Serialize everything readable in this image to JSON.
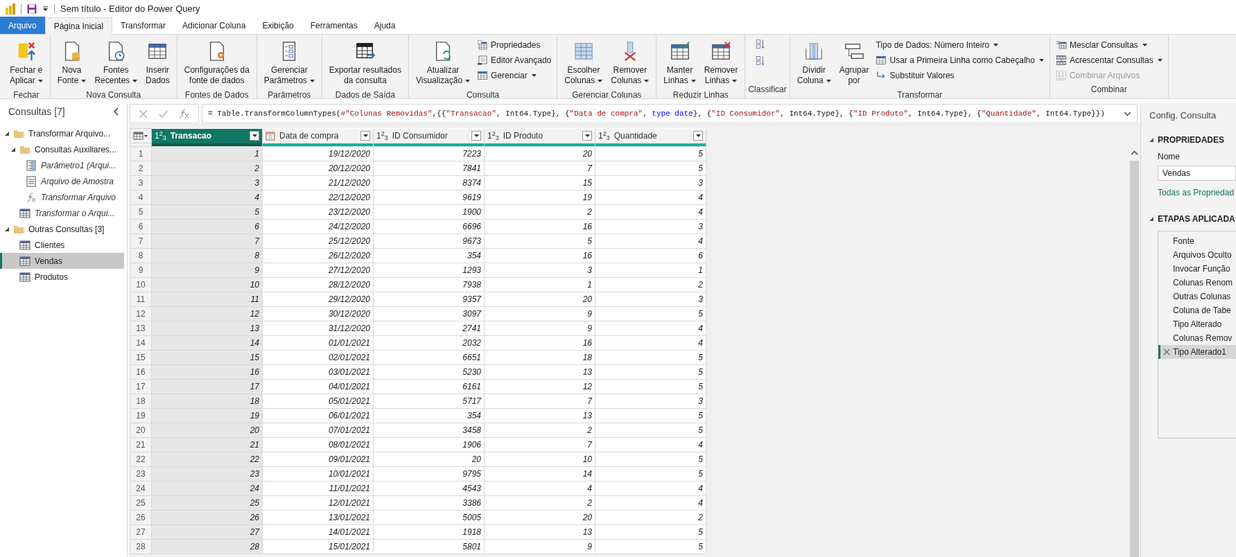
{
  "window": {
    "title": "Sem título - Editor do Power Query"
  },
  "tabs": [
    {
      "label": "Arquivo",
      "kind": "file",
      "selected": false
    },
    {
      "label": "Página Inicial",
      "kind": "tab",
      "selected": true
    },
    {
      "label": "Transformar",
      "kind": "tab",
      "selected": false
    },
    {
      "label": "Adicionar Coluna",
      "kind": "tab",
      "selected": false
    },
    {
      "label": "Exibição",
      "kind": "tab",
      "selected": false
    },
    {
      "label": "Ferramentas",
      "kind": "tab",
      "selected": false
    },
    {
      "label": "Ajuda",
      "kind": "tab",
      "selected": false
    }
  ],
  "ribbon": {
    "groups": [
      {
        "label": "Fechar",
        "items": [
          {
            "kind": "large",
            "lines": [
              "Fechar e",
              "Aplicar"
            ],
            "dropdown": true
          }
        ]
      },
      {
        "label": "Nova Consulta",
        "items": [
          {
            "kind": "large",
            "lines": [
              "Nova",
              "Fonte"
            ],
            "dropdown": true
          },
          {
            "kind": "large",
            "lines": [
              "Fontes",
              "Recentes"
            ],
            "dropdown": true
          },
          {
            "kind": "large",
            "lines": [
              "Inserir",
              "Dados"
            ],
            "dropdown": false
          }
        ]
      },
      {
        "label": "Fontes de Dados",
        "items": [
          {
            "kind": "large",
            "lines": [
              "Configurações da",
              "fonte de dados"
            ],
            "dropdown": false
          }
        ]
      },
      {
        "label": "Parâmetros",
        "items": [
          {
            "kind": "large",
            "lines": [
              "Gerenciar",
              "Parâmetros"
            ],
            "dropdown": true
          }
        ]
      },
      {
        "label": "Dados de Saída",
        "items": [
          {
            "kind": "large",
            "lines": [
              "Exportar resultados",
              "da consulta"
            ],
            "dropdown": false
          }
        ]
      },
      {
        "label": "Consulta",
        "items": [
          {
            "kind": "large",
            "lines": [
              "Atualizar",
              "Visualização"
            ],
            "dropdown": true
          },
          {
            "kind": "small",
            "label": "Propriedades",
            "dropdown": false,
            "disabled": false
          },
          {
            "kind": "small",
            "label": "Editor Avançado",
            "dropdown": false,
            "disabled": false
          },
          {
            "kind": "small",
            "label": "Gerenciar",
            "dropdown": true,
            "disabled": false
          }
        ]
      },
      {
        "label": "Gerenciar Colunas",
        "items": [
          {
            "kind": "large",
            "lines": [
              "Escolher",
              "Colunas"
            ],
            "dropdown": true
          },
          {
            "kind": "large",
            "lines": [
              "Remover",
              "Colunas"
            ],
            "dropdown": true
          }
        ]
      },
      {
        "label": "Reduzir Linhas",
        "items": [
          {
            "kind": "large",
            "lines": [
              "Manter",
              "Linhas"
            ],
            "dropdown": true
          },
          {
            "kind": "large",
            "lines": [
              "Remover",
              "Linhas"
            ],
            "dropdown": true
          }
        ]
      },
      {
        "label": "Classificar",
        "items": [
          {
            "kind": "icon"
          },
          {
            "kind": "icon"
          }
        ]
      },
      {
        "label": "Transformar",
        "items": [
          {
            "kind": "large",
            "lines": [
              "Dividir",
              "Coluna"
            ],
            "dropdown": true
          },
          {
            "kind": "large",
            "lines": [
              "Agrupar",
              "por"
            ],
            "dropdown": false
          },
          {
            "kind": "small",
            "label": "Tipo de Dados: Número Inteiro",
            "dropdown": true,
            "disabled": false
          },
          {
            "kind": "small",
            "label": "Usar a Primeira Linha como Cabeçalho",
            "dropdown": true,
            "disabled": false
          },
          {
            "kind": "small",
            "label": "Substituir Valores",
            "dropdown": false,
            "disabled": false
          }
        ]
      },
      {
        "label": "Combinar",
        "items": [
          {
            "kind": "small",
            "label": "Mesclar Consultas",
            "dropdown": true,
            "disabled": false
          },
          {
            "kind": "small",
            "label": "Acrescentar Consultas",
            "dropdown": true,
            "disabled": false
          },
          {
            "kind": "small",
            "label": "Combinar Arquivos",
            "dropdown": false,
            "disabled": true
          }
        ]
      }
    ]
  },
  "queries": {
    "title": "Consultas [7]",
    "items": [
      {
        "label": "Transformar Arquivo...",
        "kind": "folder",
        "italic": false,
        "selected": false,
        "expanded": true,
        "children": [
          {
            "label": "Consultas Auxiliares...",
            "kind": "folder",
            "italic": false,
            "selected": false,
            "expanded": true,
            "children": [
              {
                "label": "Parâmetro1 (Arqui...",
                "kind": "param",
                "italic": true,
                "selected": false
              },
              {
                "label": "Arquivo de Amostra",
                "kind": "file",
                "italic": true,
                "selected": false
              },
              {
                "label": "Transformar Arquivo",
                "kind": "function",
                "italic": true,
                "selected": false
              }
            ]
          },
          {
            "label": "Transformar o Arqui...",
            "kind": "table",
            "italic": true,
            "selected": false
          }
        ]
      },
      {
        "label": "Outras Consultas [3]",
        "kind": "folder",
        "italic": false,
        "selected": false,
        "expanded": true,
        "children": [
          {
            "label": "Clientes",
            "kind": "table",
            "italic": false,
            "selected": false
          },
          {
            "label": "Vendas",
            "kind": "table",
            "italic": false,
            "selected": true
          },
          {
            "label": "Produtos",
            "kind": "table",
            "italic": false,
            "selected": false
          }
        ]
      }
    ]
  },
  "formula": [
    {
      "text": "= Table.TransformColumnTypes(",
      "kind": "plain"
    },
    {
      "text": "#\"Colunas Removidas\"",
      "kind": "string"
    },
    {
      "text": ",{{",
      "kind": "plain"
    },
    {
      "text": "\"Transacao\"",
      "kind": "string"
    },
    {
      "text": ", Int64.Type}, {",
      "kind": "plain"
    },
    {
      "text": "\"Data de compra\"",
      "kind": "string"
    },
    {
      "text": ", ",
      "kind": "plain"
    },
    {
      "text": "type date",
      "kind": "keyword"
    },
    {
      "text": "}, {",
      "kind": "plain"
    },
    {
      "text": "\"ID Consumidor\"",
      "kind": "string"
    },
    {
      "text": ", Int64.Type}, {",
      "kind": "plain"
    },
    {
      "text": "\"ID Produto\"",
      "kind": "string"
    },
    {
      "text": ", Int64.Type}, {",
      "kind": "plain"
    },
    {
      "text": "\"Quantidade\"",
      "kind": "string"
    },
    {
      "text": ", Int64.Type}})",
      "kind": "plain"
    }
  ],
  "table": {
    "columns": [
      {
        "name": "Transacao",
        "kind": "int",
        "type_symbol": "1$^{2}$$_{3}$",
        "selected": true
      },
      {
        "name": "Data de compra",
        "kind": "date",
        "selected": false
      },
      {
        "name": "ID Consumidor",
        "kind": "int",
        "type_symbol": "1$^{2}$$_{3}$",
        "selected": false
      },
      {
        "name": "ID Produto",
        "kind": "int",
        "type_symbol": "1$^{2}$$_{3}$",
        "selected": false
      },
      {
        "name": "Quantidade",
        "kind": "int",
        "type_symbol": "1$^{2}$$_{3}$",
        "selected": false
      }
    ],
    "rows": [
      {
        "number": "1",
        "cells": [
          "1",
          "19/12/2020",
          "7223",
          "20",
          "5"
        ]
      },
      {
        "number": "2",
        "cells": [
          "2",
          "20/12/2020",
          "7841",
          "7",
          "5"
        ]
      },
      {
        "number": "3",
        "cells": [
          "3",
          "21/12/2020",
          "8374",
          "15",
          "3"
        ]
      },
      {
        "number": "4",
        "cells": [
          "4",
          "22/12/2020",
          "9619",
          "19",
          "4"
        ]
      },
      {
        "number": "5",
        "cells": [
          "5",
          "23/12/2020",
          "1900",
          "2",
          "4"
        ]
      },
      {
        "number": "6",
        "cells": [
          "6",
          "24/12/2020",
          "6696",
          "16",
          "3"
        ]
      },
      {
        "number": "7",
        "cells": [
          "7",
          "25/12/2020",
          "9673",
          "5",
          "4"
        ]
      },
      {
        "number": "8",
        "cells": [
          "8",
          "26/12/2020",
          "354",
          "16",
          "6"
        ]
      },
      {
        "number": "9",
        "cells": [
          "9",
          "27/12/2020",
          "1293",
          "3",
          "1"
        ]
      },
      {
        "number": "10",
        "cells": [
          "10",
          "28/12/2020",
          "7938",
          "1",
          "2"
        ]
      },
      {
        "number": "11",
        "cells": [
          "11",
          "29/12/2020",
          "9357",
          "20",
          "3"
        ]
      },
      {
        "number": "12",
        "cells": [
          "12",
          "30/12/2020",
          "3097",
          "9",
          "5"
        ]
      },
      {
        "number": "13",
        "cells": [
          "13",
          "31/12/2020",
          "2741",
          "9",
          "4"
        ]
      },
      {
        "number": "14",
        "cells": [
          "14",
          "01/01/2021",
          "2032",
          "16",
          "4"
        ]
      },
      {
        "number": "15",
        "cells": [
          "15",
          "02/01/2021",
          "6651",
          "18",
          "5"
        ]
      },
      {
        "number": "16",
        "cells": [
          "16",
          "03/01/2021",
          "5230",
          "13",
          "5"
        ]
      },
      {
        "number": "17",
        "cells": [
          "17",
          "04/01/2021",
          "6161",
          "12",
          "5"
        ]
      },
      {
        "number": "18",
        "cells": [
          "18",
          "05/01/2021",
          "5717",
          "7",
          "3"
        ]
      },
      {
        "number": "19",
        "cells": [
          "19",
          "06/01/2021",
          "354",
          "13",
          "5"
        ]
      },
      {
        "number": "20",
        "cells": [
          "20",
          "07/01/2021",
          "3458",
          "2",
          "5"
        ]
      },
      {
        "number": "21",
        "cells": [
          "21",
          "08/01/2021",
          "1906",
          "7",
          "4"
        ]
      },
      {
        "number": "22",
        "cells": [
          "22",
          "09/01/2021",
          "20",
          "10",
          "5"
        ]
      },
      {
        "number": "23",
        "cells": [
          "23",
          "10/01/2021",
          "9795",
          "14",
          "5"
        ]
      },
      {
        "number": "24",
        "cells": [
          "24",
          "11/01/2021",
          "4543",
          "4",
          "4"
        ]
      },
      {
        "number": "25",
        "cells": [
          "25",
          "12/01/2021",
          "3386",
          "2",
          "4"
        ]
      },
      {
        "number": "26",
        "cells": [
          "26",
          "13/01/2021",
          "5005",
          "20",
          "2"
        ]
      },
      {
        "number": "27",
        "cells": [
          "27",
          "14/01/2021",
          "1918",
          "13",
          "5"
        ]
      },
      {
        "number": "28",
        "cells": [
          "28",
          "15/01/2021",
          "5801",
          "9",
          "5"
        ]
      }
    ]
  },
  "settings": {
    "title": "Config. Consulta",
    "properties_heading": "PROPRIEDADES",
    "name_label": "Nome",
    "name_value": "Vendas",
    "all_properties_link": "Todas as Propriedad",
    "steps_heading": "ETAPAS APLICADA",
    "steps": [
      {
        "label": "Fonte",
        "selected": false
      },
      {
        "label": "Arquivos Oculto",
        "selected": false
      },
      {
        "label": "Invocar Função",
        "selected": false
      },
      {
        "label": "Colunas Renom",
        "selected": false
      },
      {
        "label": "Outras Colunas",
        "selected": false
      },
      {
        "label": "Coluna de Tabe",
        "selected": false
      },
      {
        "label": "Tipo Alterado",
        "selected": false
      },
      {
        "label": "Colunas Remov",
        "selected": false
      },
      {
        "label": "Tipo Alterado1",
        "selected": true
      }
    ]
  }
}
